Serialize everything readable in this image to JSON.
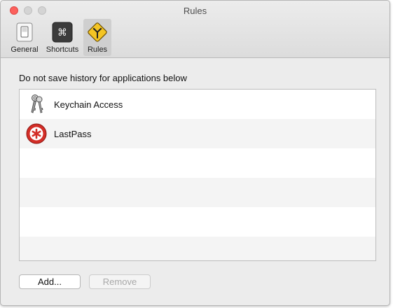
{
  "window": {
    "title": "Rules"
  },
  "toolbar": {
    "items": [
      {
        "label": "General",
        "icon": "switch-icon",
        "selected": false
      },
      {
        "label": "Shortcuts",
        "icon": "command-key-icon",
        "selected": false
      },
      {
        "label": "Rules",
        "icon": "road-sign-icon",
        "selected": true
      }
    ]
  },
  "rules": {
    "caption": "Do not save history for applications below",
    "apps": [
      {
        "name": "Keychain Access",
        "icon": "keys-icon"
      },
      {
        "name": "LastPass",
        "icon": "lastpass-icon"
      }
    ],
    "add_label": "Add...",
    "remove_label": "Remove"
  },
  "colors": {
    "close_button": "#fc605c",
    "selected_tab": "#cfcfcf",
    "lastpass_red": "#d32d27",
    "rules_sign": "#f4c524"
  }
}
